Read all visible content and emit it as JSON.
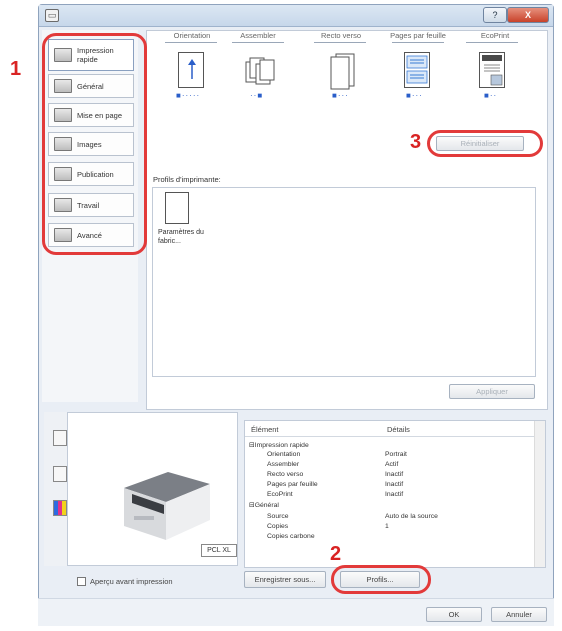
{
  "window": {
    "icon": "printer-icon",
    "help_button": "?",
    "close_button": "X"
  },
  "sidebar": {
    "items": [
      {
        "label": "Impression rapide",
        "icon": "quick-print-icon"
      },
      {
        "label": "Général",
        "icon": "general-icon"
      },
      {
        "label": "Mise en page",
        "icon": "layout-icon"
      },
      {
        "label": "Images",
        "icon": "images-icon"
      },
      {
        "label": "Publication",
        "icon": "publication-icon"
      },
      {
        "label": "Travail",
        "icon": "job-icon"
      },
      {
        "label": "Avancé",
        "icon": "advanced-icon"
      }
    ]
  },
  "annotations": {
    "step1": "1",
    "step2": "2",
    "step3": "3",
    "highlight_color": "#e23a3a"
  },
  "quick_print": {
    "columns": [
      {
        "label": "Orientation",
        "icon": "portrait-arrow-icon"
      },
      {
        "label": "Assembler",
        "icon": "collate-icon"
      },
      {
        "label": "Recto verso",
        "icon": "duplex-icon"
      },
      {
        "label": "Pages par feuille",
        "icon": "pages-per-sheet-icon"
      },
      {
        "label": "EcoPrint",
        "icon": "ecoprint-icon"
      }
    ],
    "reset_button": "Réinitialiser",
    "profiles_label": "Profils d'imprimante:",
    "profile_item": "Paramètres du fabric...",
    "apply_button": "Appliquer"
  },
  "preview": {
    "badge": "PCL XL",
    "checkbox_label": "Aperçu avant impression"
  },
  "settings_table": {
    "headers": [
      "Élément",
      "Détails"
    ],
    "rows": [
      {
        "item": "⊟Impression rapide",
        "detail": ""
      },
      {
        "item": "Orientation",
        "detail": "Portrait"
      },
      {
        "item": "Assembler",
        "detail": "Actif"
      },
      {
        "item": "Recto verso",
        "detail": "Inactif"
      },
      {
        "item": "Pages par feuille",
        "detail": "Inactif"
      },
      {
        "item": "EcoPrint",
        "detail": "Inactif"
      },
      {
        "item": "⊟Général",
        "detail": ""
      },
      {
        "item": "Source",
        "detail": "Auto de la source"
      },
      {
        "item": "Copies",
        "detail": "1"
      },
      {
        "item": "Copies carbone",
        "detail": ""
      }
    ]
  },
  "buttons": {
    "save_as": "Enregistrer sous...",
    "profiles": "Profils...",
    "ok": "OK",
    "cancel": "Annuler"
  }
}
